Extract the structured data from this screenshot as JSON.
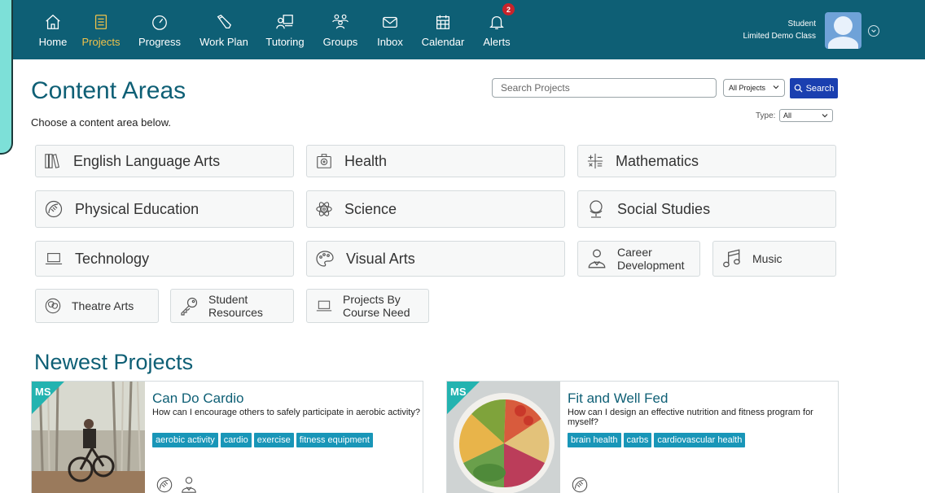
{
  "nav": {
    "items": [
      {
        "label": "Home",
        "icon": "home-icon"
      },
      {
        "label": "Projects",
        "icon": "notebook-icon",
        "active": true
      },
      {
        "label": "Progress",
        "icon": "gauge-icon"
      },
      {
        "label": "Work Plan",
        "icon": "pencil-icon"
      },
      {
        "label": "Tutoring",
        "icon": "teacher-icon"
      },
      {
        "label": "Groups",
        "icon": "groups-icon"
      },
      {
        "label": "Inbox",
        "icon": "envelope-icon"
      },
      {
        "label": "Calendar",
        "icon": "calendar-icon"
      },
      {
        "label": "Alerts",
        "icon": "bell-icon",
        "badge": "2"
      }
    ],
    "user": {
      "name": "Student",
      "class": "Limited Demo Class"
    }
  },
  "header": {
    "title": "Content Areas",
    "subtitle": "Choose a content area below."
  },
  "search": {
    "placeholder": "Search Projects",
    "scope": "All Projects",
    "button": "Search",
    "type_label": "Type:",
    "type_value": "All"
  },
  "content_areas": [
    {
      "label": "English Language Arts",
      "icon": "books-icon"
    },
    {
      "label": "Health",
      "icon": "first-aid-icon"
    },
    {
      "label": "Mathematics",
      "icon": "math-symbols-icon"
    },
    {
      "label": "Physical Education",
      "icon": "football-icon"
    },
    {
      "label": "Science",
      "icon": "atom-icon"
    },
    {
      "label": "Social Studies",
      "icon": "globe-icon"
    },
    {
      "label": "Technology",
      "icon": "laptop-icon"
    },
    {
      "label": "Visual Arts",
      "icon": "palette-icon"
    },
    {
      "label": "Career Development",
      "icon": "career-person-icon"
    },
    {
      "label": "Music",
      "icon": "music-note-icon"
    },
    {
      "label": "Theatre Arts",
      "icon": "theatre-masks-icon"
    },
    {
      "label": "Student Resources",
      "icon": "key-icon"
    },
    {
      "label": "Projects By Course Need",
      "icon": "laptop-icon"
    }
  ],
  "newest": {
    "title": "Newest Projects",
    "cards": [
      {
        "level": "MS",
        "title": "Can Do Cardio",
        "question": "How can I encourage others to safely participate in aerobic activity?",
        "tags": [
          "aerobic activity",
          "cardio",
          "exercise",
          "fitness equipment"
        ],
        "icons": [
          "football-icon",
          "career-person-icon"
        ]
      },
      {
        "level": "MS",
        "title": "Fit and Well Fed",
        "question": "How can I design an effective nutrition and fitness program for myself?",
        "tags": [
          "brain health",
          "carbs",
          "cardiovascular health"
        ],
        "icons": [
          "football-icon"
        ]
      }
    ]
  },
  "colors": {
    "nav_bg": "#0e5f75",
    "active": "#f0c24a",
    "accent": "#1a3fb0",
    "tag": "#1996b8",
    "ms_badge": "#23b3b0"
  }
}
